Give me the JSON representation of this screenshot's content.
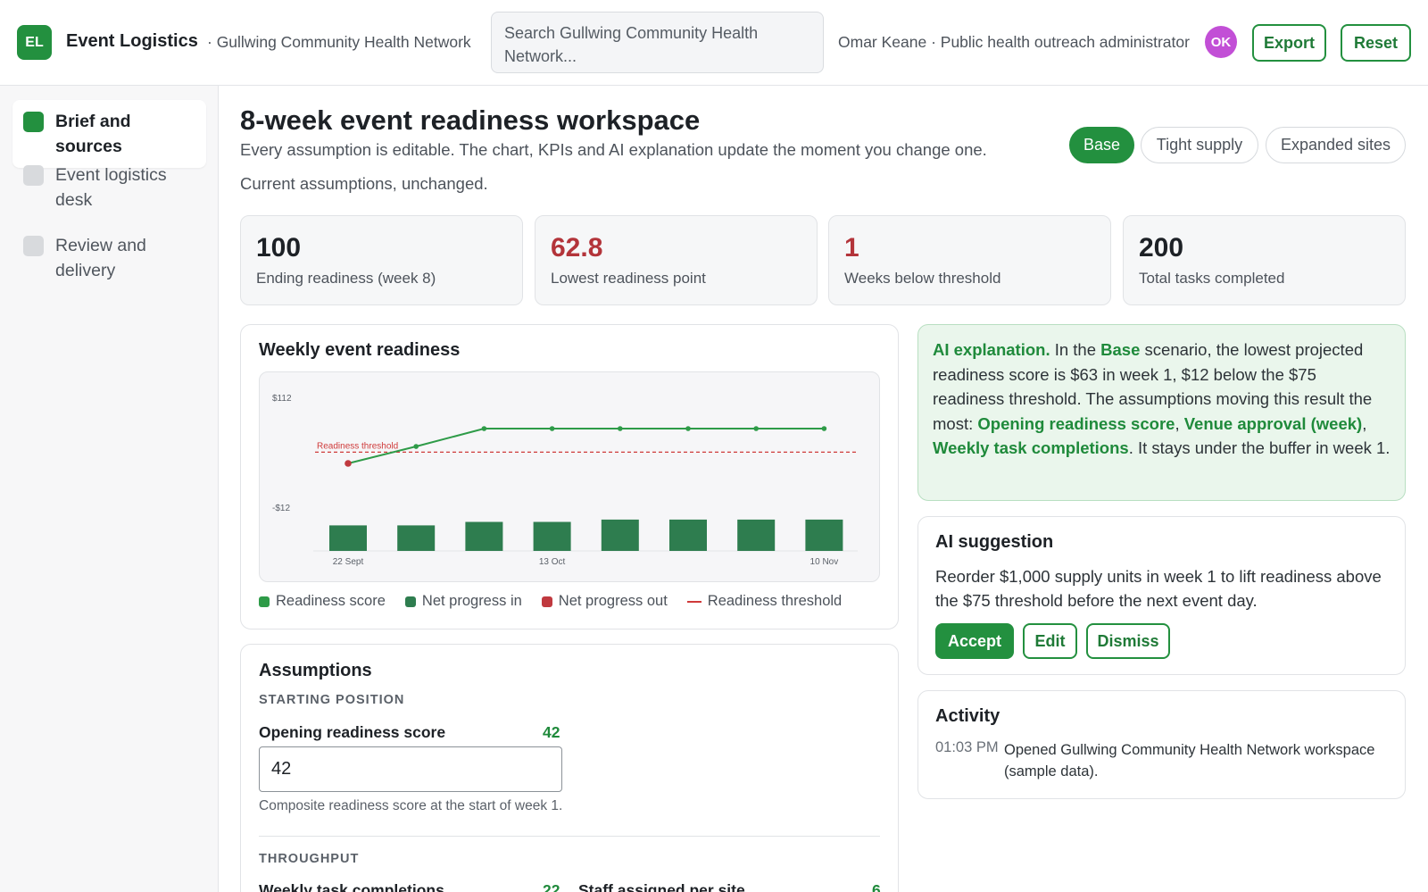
{
  "app": {
    "logo_initials": "EL",
    "title": "Event Logistics",
    "org": "· Gullwing Community Health Network",
    "search_placeholder": "Search Gullwing Community Health Network...",
    "user": "Omar Keane · Public health outreach administrator",
    "avatar_initials": "OK",
    "export_label": "Export",
    "reset_label": "Reset",
    "brand_color": "#23903f"
  },
  "sidebar": {
    "items": [
      {
        "label": "Brief and sources",
        "active": true
      },
      {
        "label": "Event logistics desk",
        "active": false
      },
      {
        "label": "Review and delivery",
        "active": false
      }
    ]
  },
  "header": {
    "title": "8-week event readiness workspace",
    "subtitle": "Every assumption is editable. The chart, KPIs and AI explanation update the moment you change one.",
    "status": "Current assumptions, unchanged.",
    "scenarios": [
      "Base",
      "Tight supply",
      "Expanded sites"
    ],
    "active_scenario": "Base"
  },
  "kpis": [
    {
      "value": "100",
      "label": "Ending readiness (week 8)",
      "alert": false
    },
    {
      "value": "62.8",
      "label": "Lowest readiness point",
      "alert": true
    },
    {
      "value": "1",
      "label": "Weeks below threshold",
      "alert": true
    },
    {
      "value": "200",
      "label": "Total tasks completed",
      "alert": false
    }
  ],
  "chart": {
    "title": "Weekly event readiness",
    "legend": [
      "Readiness score",
      "Net progress in",
      "Net progress out",
      "Readiness threshold"
    ],
    "colors": {
      "line": "#2e9b48",
      "bar": "#2e7d4f",
      "out": "#c0393f",
      "threshold": "#cf3a3a"
    },
    "threshold_label": "Readiness threshold"
  },
  "chart_data": {
    "type": "bar",
    "title": "Weekly event readiness",
    "y_tick_labels": [
      "$112",
      "-$12"
    ],
    "x_tick_labels": [
      "22 Sept",
      "13 Oct",
      "10 Nov"
    ],
    "x": [
      "Week 1",
      "Week 2",
      "Week 3",
      "Week 4",
      "Week 5",
      "Week 6",
      "Week 7",
      "Week 8"
    ],
    "series": [
      {
        "name": "Readiness score",
        "type": "line",
        "values": [
          63,
          81,
          100,
          100,
          100,
          100,
          100,
          100
        ]
      },
      {
        "name": "Net progress in",
        "type": "bar",
        "values": [
          22,
          22,
          25,
          25,
          27,
          27,
          27,
          27
        ]
      },
      {
        "name": "Net progress out",
        "type": "bar",
        "values": [
          0,
          0,
          0,
          0,
          0,
          0,
          0,
          0
        ]
      }
    ],
    "threshold": 75,
    "below_threshold_weeks": [
      1
    ]
  },
  "ai_explanation": {
    "lead": "AI explanation.",
    "t1": " In the ",
    "scenario": "Base",
    "t2": " scenario, the lowest projected readiness score is $63 in week 1, $12 below the $75 readiness threshold. The assumptions moving this result the most: ",
    "d1": "Opening readiness score",
    "sep1": ", ",
    "d2": "Venue approval (week)",
    "sep2": ", ",
    "d3": "Weekly task completions",
    "t3": ". It stays under the buffer in week 1."
  },
  "suggestion": {
    "title": "AI suggestion",
    "text": "Reorder $1,000 supply units in week 1 to lift readiness above the $75 threshold before the next event day.",
    "accept": "Accept",
    "edit": "Edit",
    "dismiss": "Dismiss"
  },
  "activity": {
    "title": "Activity",
    "entries": [
      {
        "time": "01:03 PM",
        "text": "Opened Gullwing Community Health Network workspace (sample data)."
      }
    ]
  },
  "assumptions": {
    "title": "Assumptions",
    "starting_heading": "STARTING POSITION",
    "opening_label": "Opening readiness score",
    "opening_value": "42",
    "opening_input": "42",
    "opening_help": "Composite readiness score at the start of week 1.",
    "throughput_heading": "THROUGHPUT",
    "weekly_label": "Weekly task completions",
    "weekly_value": "22",
    "staff_label": "Staff assigned per site",
    "staff_value": "6"
  }
}
